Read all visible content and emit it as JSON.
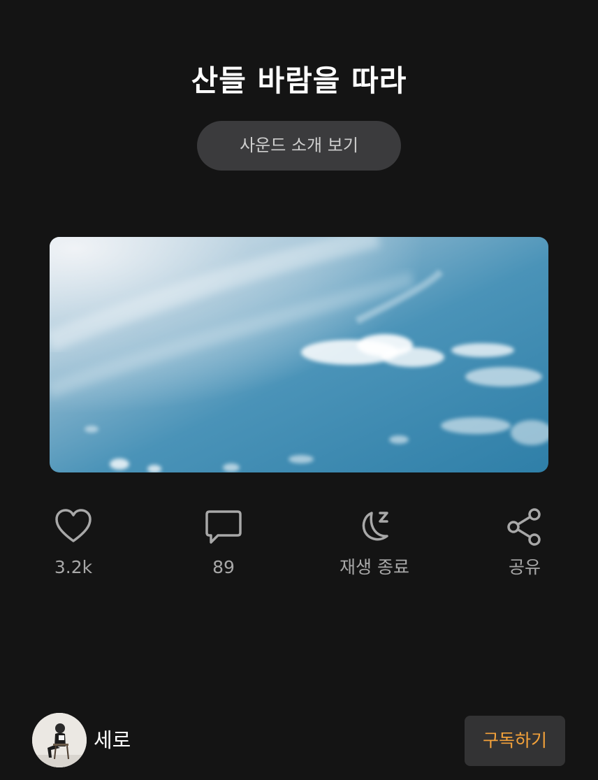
{
  "title": "산들 바람을 따라",
  "intro_button": "사운드 소개 보기",
  "cover": {
    "description_icon": "sky-clouds-image"
  },
  "actions": [
    {
      "icon": "heart-icon",
      "label": "3.2k"
    },
    {
      "icon": "comment-icon",
      "label": "89"
    },
    {
      "icon": "sleep-timer-icon",
      "label": "재생 종료"
    },
    {
      "icon": "share-icon",
      "label": "공유"
    }
  ],
  "channel": {
    "name": "세로",
    "avatar": "person-sitting-avatar"
  },
  "subscribe_label": "구독하기",
  "colors": {
    "background": "#141414",
    "accent": "#f4a23a",
    "icon": "#a8a8a8"
  }
}
